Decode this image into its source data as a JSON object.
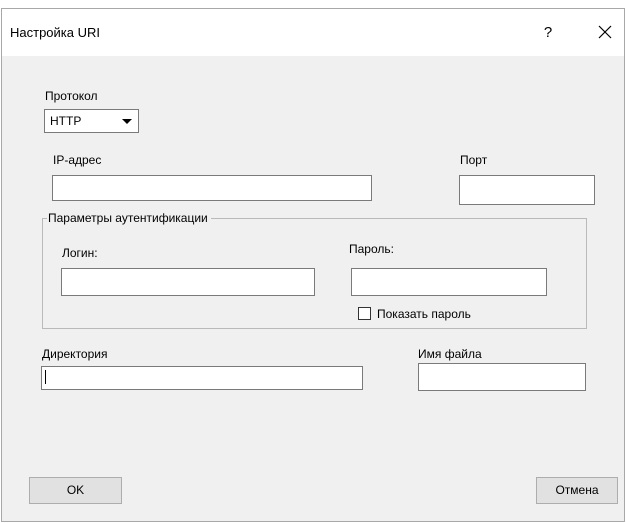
{
  "dialog": {
    "title": "Настройка URI",
    "help_label": "?"
  },
  "protocol": {
    "label": "Протокол",
    "selected": "HTTP"
  },
  "ip": {
    "label": "IP-адрес",
    "value": ""
  },
  "port": {
    "label": "Порт",
    "value": ""
  },
  "auth": {
    "group_label": "Параметры аутентификации",
    "login_label": "Логин:",
    "login_value": "",
    "password_label": "Пароль:",
    "password_value": "",
    "show_password_label": "Показать пароль",
    "show_password_checked": false
  },
  "directory": {
    "label": "Директория",
    "value": ""
  },
  "filename": {
    "label": "Имя файла",
    "value": ""
  },
  "buttons": {
    "ok": "OK",
    "cancel": "Отмена"
  }
}
